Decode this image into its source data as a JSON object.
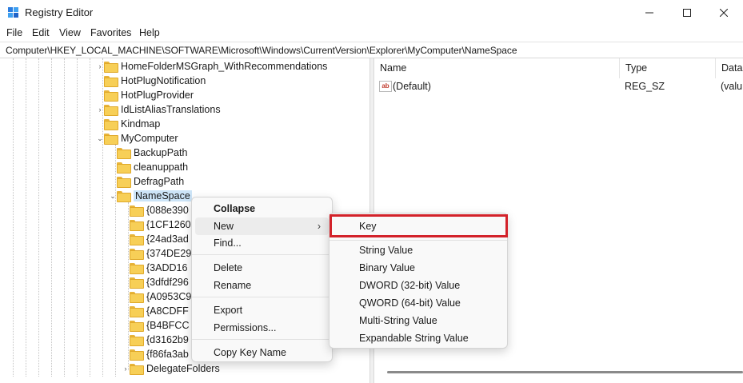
{
  "window": {
    "title": "Registry Editor",
    "minimize_glyph": "—",
    "maximize_glyph": "☐",
    "close_glyph": "✕"
  },
  "menubar": {
    "items": [
      "File",
      "Edit",
      "View",
      "Favorites",
      "Help"
    ]
  },
  "address": {
    "path": "Computer\\HKEY_LOCAL_MACHINE\\SOFTWARE\\Microsoft\\Windows\\CurrentVersion\\Explorer\\MyComputer\\NameSpace"
  },
  "tree": {
    "nodes": [
      {
        "label": "HomeFolderMSGraph_WithRecommendations",
        "expander": "›"
      },
      {
        "label": "HotPlugNotification",
        "expander": ""
      },
      {
        "label": "HotPlugProvider",
        "expander": ""
      },
      {
        "label": "IdListAliasTranslations",
        "expander": "›"
      },
      {
        "label": "Kindmap",
        "expander": ""
      },
      {
        "label": "MyComputer",
        "expander": "⌄"
      },
      {
        "label": "BackupPath",
        "expander": ""
      },
      {
        "label": "cleanuppath",
        "expander": ""
      },
      {
        "label": "DefragPath",
        "expander": ""
      },
      {
        "label": "NameSpace",
        "expander": "⌄"
      },
      {
        "label": "{088e390",
        "expander": ""
      },
      {
        "label": "{1CF1260",
        "expander": ""
      },
      {
        "label": "{24ad3ad",
        "expander": ""
      },
      {
        "label": "{374DE29",
        "expander": ""
      },
      {
        "label": "{3ADD16",
        "expander": ""
      },
      {
        "label": "{3dfdf296",
        "expander": ""
      },
      {
        "label": "{A0953C9",
        "expander": ""
      },
      {
        "label": "{A8CDFF",
        "expander": ""
      },
      {
        "label": "{B4BFCC",
        "expander": ""
      },
      {
        "label": "{d3162b9",
        "expander": ""
      },
      {
        "label": "{f86fa3ab",
        "expander": ""
      },
      {
        "label": "DelegateFolders",
        "expander": "›"
      }
    ]
  },
  "values_pane": {
    "columns": [
      "Name",
      "Type",
      "Data"
    ],
    "rows": [
      {
        "name": "(Default)",
        "type": "REG_SZ",
        "data": "(valu",
        "icon": "string-value-icon",
        "icon_text": "ab"
      }
    ]
  },
  "context_menu": {
    "collapse": "Collapse",
    "new": "New",
    "submenu_arrow": "›",
    "find": "Find...",
    "delete": "Delete",
    "rename": "Rename",
    "export": "Export",
    "permissions": "Permissions...",
    "copy_key_name": "Copy Key Name"
  },
  "new_submenu": {
    "key": "Key",
    "string_value": "String Value",
    "binary_value": "Binary Value",
    "dword_value": "DWORD (32-bit) Value",
    "qword_value": "QWORD (64-bit) Value",
    "multi_string_value": "Multi-String Value",
    "expandable_string_value": "Expandable String Value"
  },
  "colors": {
    "highlight_border": "#d3222a",
    "selection": "#cce4f7",
    "folder": "#f7cf57"
  }
}
